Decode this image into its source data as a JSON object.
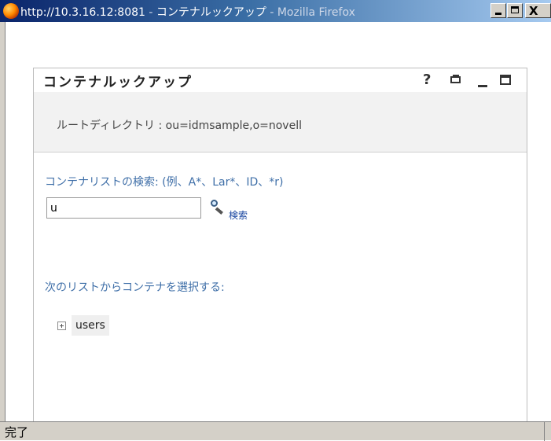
{
  "window": {
    "url": "http://10.3.16.12:8081",
    "separator": " - ",
    "page_title": "コンテナルックアップ",
    "app_name": "Mozilla Firefox",
    "close_glyph": "X"
  },
  "portlet": {
    "title": "コンテナルックアップ",
    "help_glyph": "?",
    "root_directory": "ルートディレクトリ : ou=idmsample,o=novell",
    "search_label": "コンテナリストの検索: (例、A*、Lar*、ID、*r)",
    "search_value": "u",
    "search_link": "検索",
    "select_label": "次のリストからコンテナを選択する:",
    "tree_items": [
      {
        "label": "users"
      }
    ]
  },
  "status_bar": {
    "text": "完了"
  }
}
